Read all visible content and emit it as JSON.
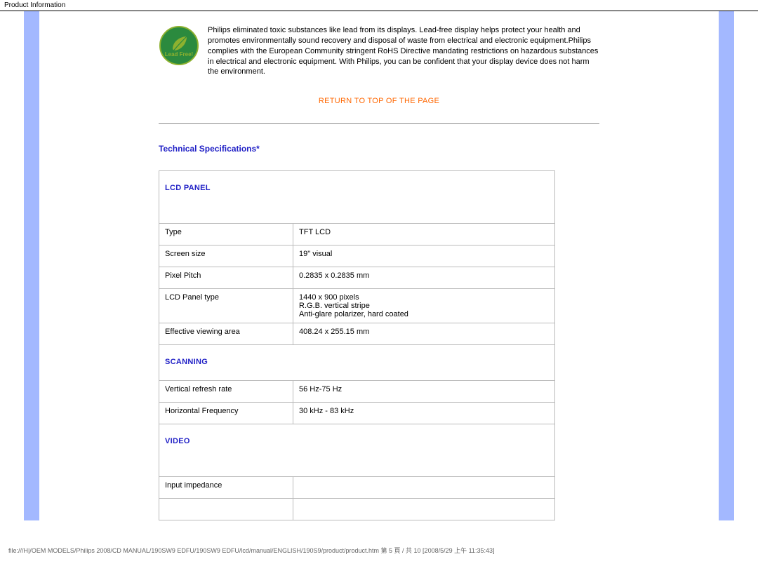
{
  "page": {
    "header": "Product Information",
    "footer": "file:///H|/OEM MODELS/Philips 2008/CD MANUAL/190SW9 EDFU/190SW9 EDFU/lcd/manual/ENGLISH/190S9/product/product.htm 第 5 頁 / 共 10 [2008/5/29 上午 11:35:43]"
  },
  "intro": {
    "badge_label": "Lead Free!",
    "text": "Philips eliminated toxic substances like lead from its displays. Lead-free display helps protect your health and promotes environmentally sound recovery and disposal of waste from electrical and electronic equipment.Philips complies with the European Community stringent RoHS Directive mandating restrictions on hazardous substances in electrical and electronic equipment. With Philips, you can be confident that your display device does not harm the environment."
  },
  "return_link": "RETURN TO TOP OF THE PAGE",
  "spec_heading": "Technical Specifications*",
  "groups": {
    "lcd_panel": {
      "title": "LCD PANEL",
      "rows": [
        {
          "label": "Type",
          "value": "TFT LCD"
        },
        {
          "label": "Screen size",
          "value": "19\" visual"
        },
        {
          "label": "Pixel Pitch",
          "value": "0.2835 x 0.2835 mm"
        },
        {
          "label": "LCD Panel type",
          "value": "1440 x 900 pixels\nR.G.B. vertical stripe\nAnti-glare polarizer, hard coated"
        },
        {
          "label": "Effective viewing area",
          "value": "408.24 x 255.15 mm"
        }
      ]
    },
    "scanning": {
      "title": "SCANNING",
      "rows": [
        {
          "label": "Vertical refresh rate",
          "value": "56 Hz-75 Hz"
        },
        {
          "label": "Horizontal Frequency",
          "value": "30 kHz - 83 kHz"
        }
      ]
    },
    "video": {
      "title": "VIDEO",
      "rows": [
        {
          "label": "Input impedance",
          "value": ""
        },
        {
          "label": "",
          "value": ""
        }
      ]
    }
  }
}
